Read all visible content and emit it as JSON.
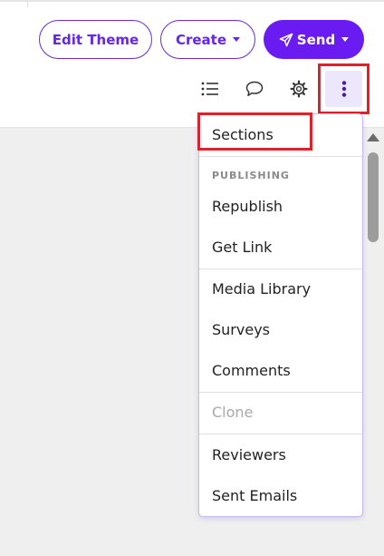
{
  "header": {
    "edit_theme_label": "Edit Theme",
    "create_label": "Create",
    "send_label": "Send"
  },
  "toolbar": {
    "icons": [
      "list-icon",
      "comment-icon",
      "gear-icon",
      "more-vertical-icon"
    ]
  },
  "menu": {
    "sections_label": "Sections",
    "publishing_header": "PUBLISHING",
    "republish_label": "Republish",
    "get_link_label": "Get Link",
    "media_library_label": "Media Library",
    "surveys_label": "Surveys",
    "comments_label": "Comments",
    "clone_label": "Clone",
    "reviewers_label": "Reviewers",
    "sent_emails_label": "Sent Emails"
  },
  "colors": {
    "accent": "#6a1bf1",
    "outline": "#6d28d9",
    "highlight": "#e0202b",
    "more_button_bg": "#ede7fb"
  }
}
